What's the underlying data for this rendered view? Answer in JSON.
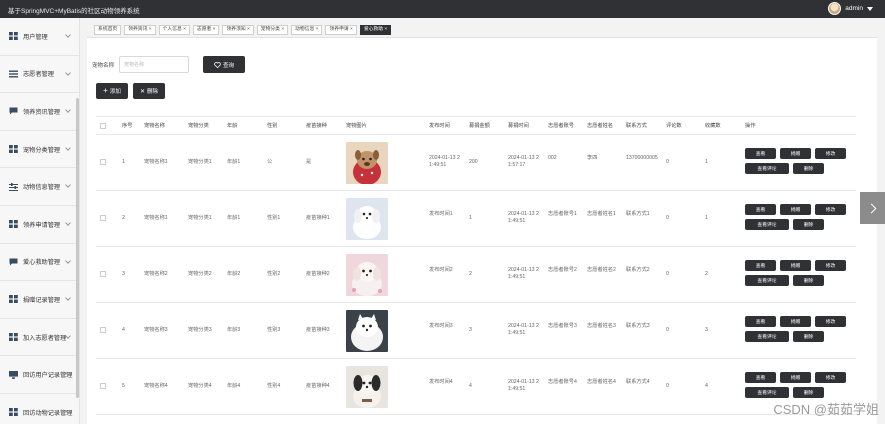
{
  "app": {
    "title": "基于SpringMVC+MyBatis的社区动物领养系统",
    "user": "admin"
  },
  "sidebar": {
    "items": [
      {
        "label": "用户管理",
        "icon": "grid-icon"
      },
      {
        "label": "志愿者管理",
        "icon": "list-icon"
      },
      {
        "label": "领养资讯管理",
        "icon": "chat-icon"
      },
      {
        "label": "宠物分类管理",
        "icon": "grid-icon"
      },
      {
        "label": "动物信息管理",
        "icon": "sliders-icon"
      },
      {
        "label": "领养申请管理",
        "icon": "grid-icon"
      },
      {
        "label": "爱心救助管理",
        "icon": "chat-icon"
      },
      {
        "label": "捐赠记录管理",
        "icon": "grid-icon"
      },
      {
        "label": "加入志愿者管理",
        "icon": "grid-icon"
      },
      {
        "label": "回访用户记录管理",
        "icon": "monitor-icon"
      },
      {
        "label": "回访动物记录管理",
        "icon": "grid-icon"
      }
    ]
  },
  "tabs": [
    {
      "label": "系统首页",
      "closable": false,
      "active": false
    },
    {
      "label": "领养资讯",
      "closable": true,
      "active": false
    },
    {
      "label": "个人信息",
      "closable": true,
      "active": false
    },
    {
      "label": "志愿者",
      "closable": true,
      "active": false
    },
    {
      "label": "领养须知",
      "closable": true,
      "active": false
    },
    {
      "label": "宠物分类",
      "closable": true,
      "active": false
    },
    {
      "label": "动物信息",
      "closable": true,
      "active": false
    },
    {
      "label": "领养申请",
      "closable": true,
      "active": false
    },
    {
      "label": "爱心救助",
      "closable": true,
      "active": true
    }
  ],
  "search": {
    "label": "宠物名称",
    "placeholder": "宠物名称",
    "button": "查询"
  },
  "toolbar": {
    "add": "添加",
    "delete": "删除"
  },
  "table": {
    "headers": [
      "序号",
      "宠物名称",
      "宠物分类",
      "年龄",
      "性别",
      "疫苗接种",
      "宠物图片",
      "发布时间",
      "募捐金额",
      "募捐时间",
      "志愿者账号",
      "志愿者姓名",
      "联系方式",
      "评论数",
      "收藏数",
      "操作"
    ],
    "rows": [
      {
        "no": "1",
        "name": "宠物名称1",
        "cat": "宠物分类1",
        "age": "年龄1",
        "sex": "公",
        "vac": "是",
        "pub": "2024-01-13 21:49:51",
        "amt": "200",
        "time": "2024-01-13 21:57:17",
        "acct": "002",
        "vname": "李四",
        "phone": "13700000005",
        "cmt": "0",
        "fav": "1",
        "img": "pet-dog-brown"
      },
      {
        "no": "2",
        "name": "宠物名称1",
        "cat": "宠物分类1",
        "age": "年龄1",
        "sex": "性别1",
        "vac": "疫苗接种1",
        "pub": "发布时间1",
        "amt": "1",
        "time": "2024-01-13 21:49:51",
        "acct": "志愿者账号1",
        "vname": "志愿者姓名1",
        "phone": "联系方式1",
        "cmt": "0",
        "fav": "1",
        "img": "pet-dog-white"
      },
      {
        "no": "3",
        "name": "宠物名称2",
        "cat": "宠物分类2",
        "age": "年龄2",
        "sex": "性别2",
        "vac": "疫苗接种2",
        "pub": "发布时间2",
        "amt": "2",
        "time": "2024-01-13 21:49:51",
        "acct": "志愿者账号2",
        "vname": "志愿者姓名2",
        "phone": "联系方式2",
        "cmt": "0",
        "fav": "2",
        "img": "pet-dog-pink"
      },
      {
        "no": "4",
        "name": "宠物名称3",
        "cat": "宠物分类3",
        "age": "年龄3",
        "sex": "性别3",
        "vac": "疫苗接种3",
        "pub": "发布时间3",
        "amt": "3",
        "time": "2024-01-13 21:49:51",
        "acct": "志愿者账号3",
        "vname": "志愿者姓名3",
        "phone": "联系方式3",
        "cmt": "0",
        "fav": "3",
        "img": "pet-dog-fluffy"
      },
      {
        "no": "5",
        "name": "宠物名称4",
        "cat": "宠物分类4",
        "age": "年龄4",
        "sex": "性别4",
        "vac": "疫苗接种4",
        "pub": "发布时间4",
        "amt": "4",
        "time": "2024-01-13 21:49:51",
        "acct": "志愿者账号4",
        "vname": "志愿者姓名4",
        "phone": "联系方式4",
        "cmt": "0",
        "fav": "4",
        "img": "pet-dog-bw"
      }
    ],
    "ops": {
      "view": "查看",
      "donate": "捐赠",
      "edit": "修改",
      "comments": "查看评论",
      "del": "删除"
    }
  },
  "watermark": "CSDN @茹茹学姐"
}
